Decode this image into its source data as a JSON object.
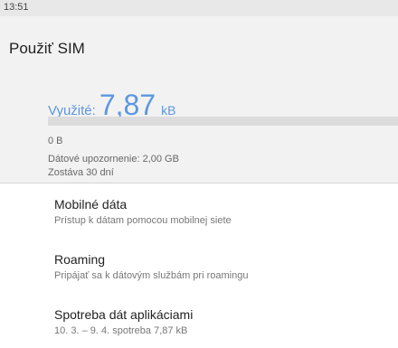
{
  "status_bar": {
    "time": "13:51"
  },
  "header": {
    "title": "Použiť SIM"
  },
  "usage": {
    "label": "Využité:",
    "value": "7,87",
    "unit": "kB",
    "bar_fill_fraction": 0.0,
    "bar_min_label": "0 B",
    "warning": "Dátové upozornenie: 2,00 GB",
    "days_left": "Zostáva 30 dní"
  },
  "settings": [
    {
      "title": "Mobilné dáta",
      "subtitle": "Prístup k dátam pomocou mobilnej siete"
    },
    {
      "title": "Roaming",
      "subtitle": "Pripájať sa k dátovým službám pri roamingu"
    },
    {
      "title": "Spotreba dát aplikáciami",
      "subtitle": "10. 3. – 9. 4. spotreba 7,87 kB"
    }
  ],
  "colors": {
    "accent": "#5b97e0"
  }
}
